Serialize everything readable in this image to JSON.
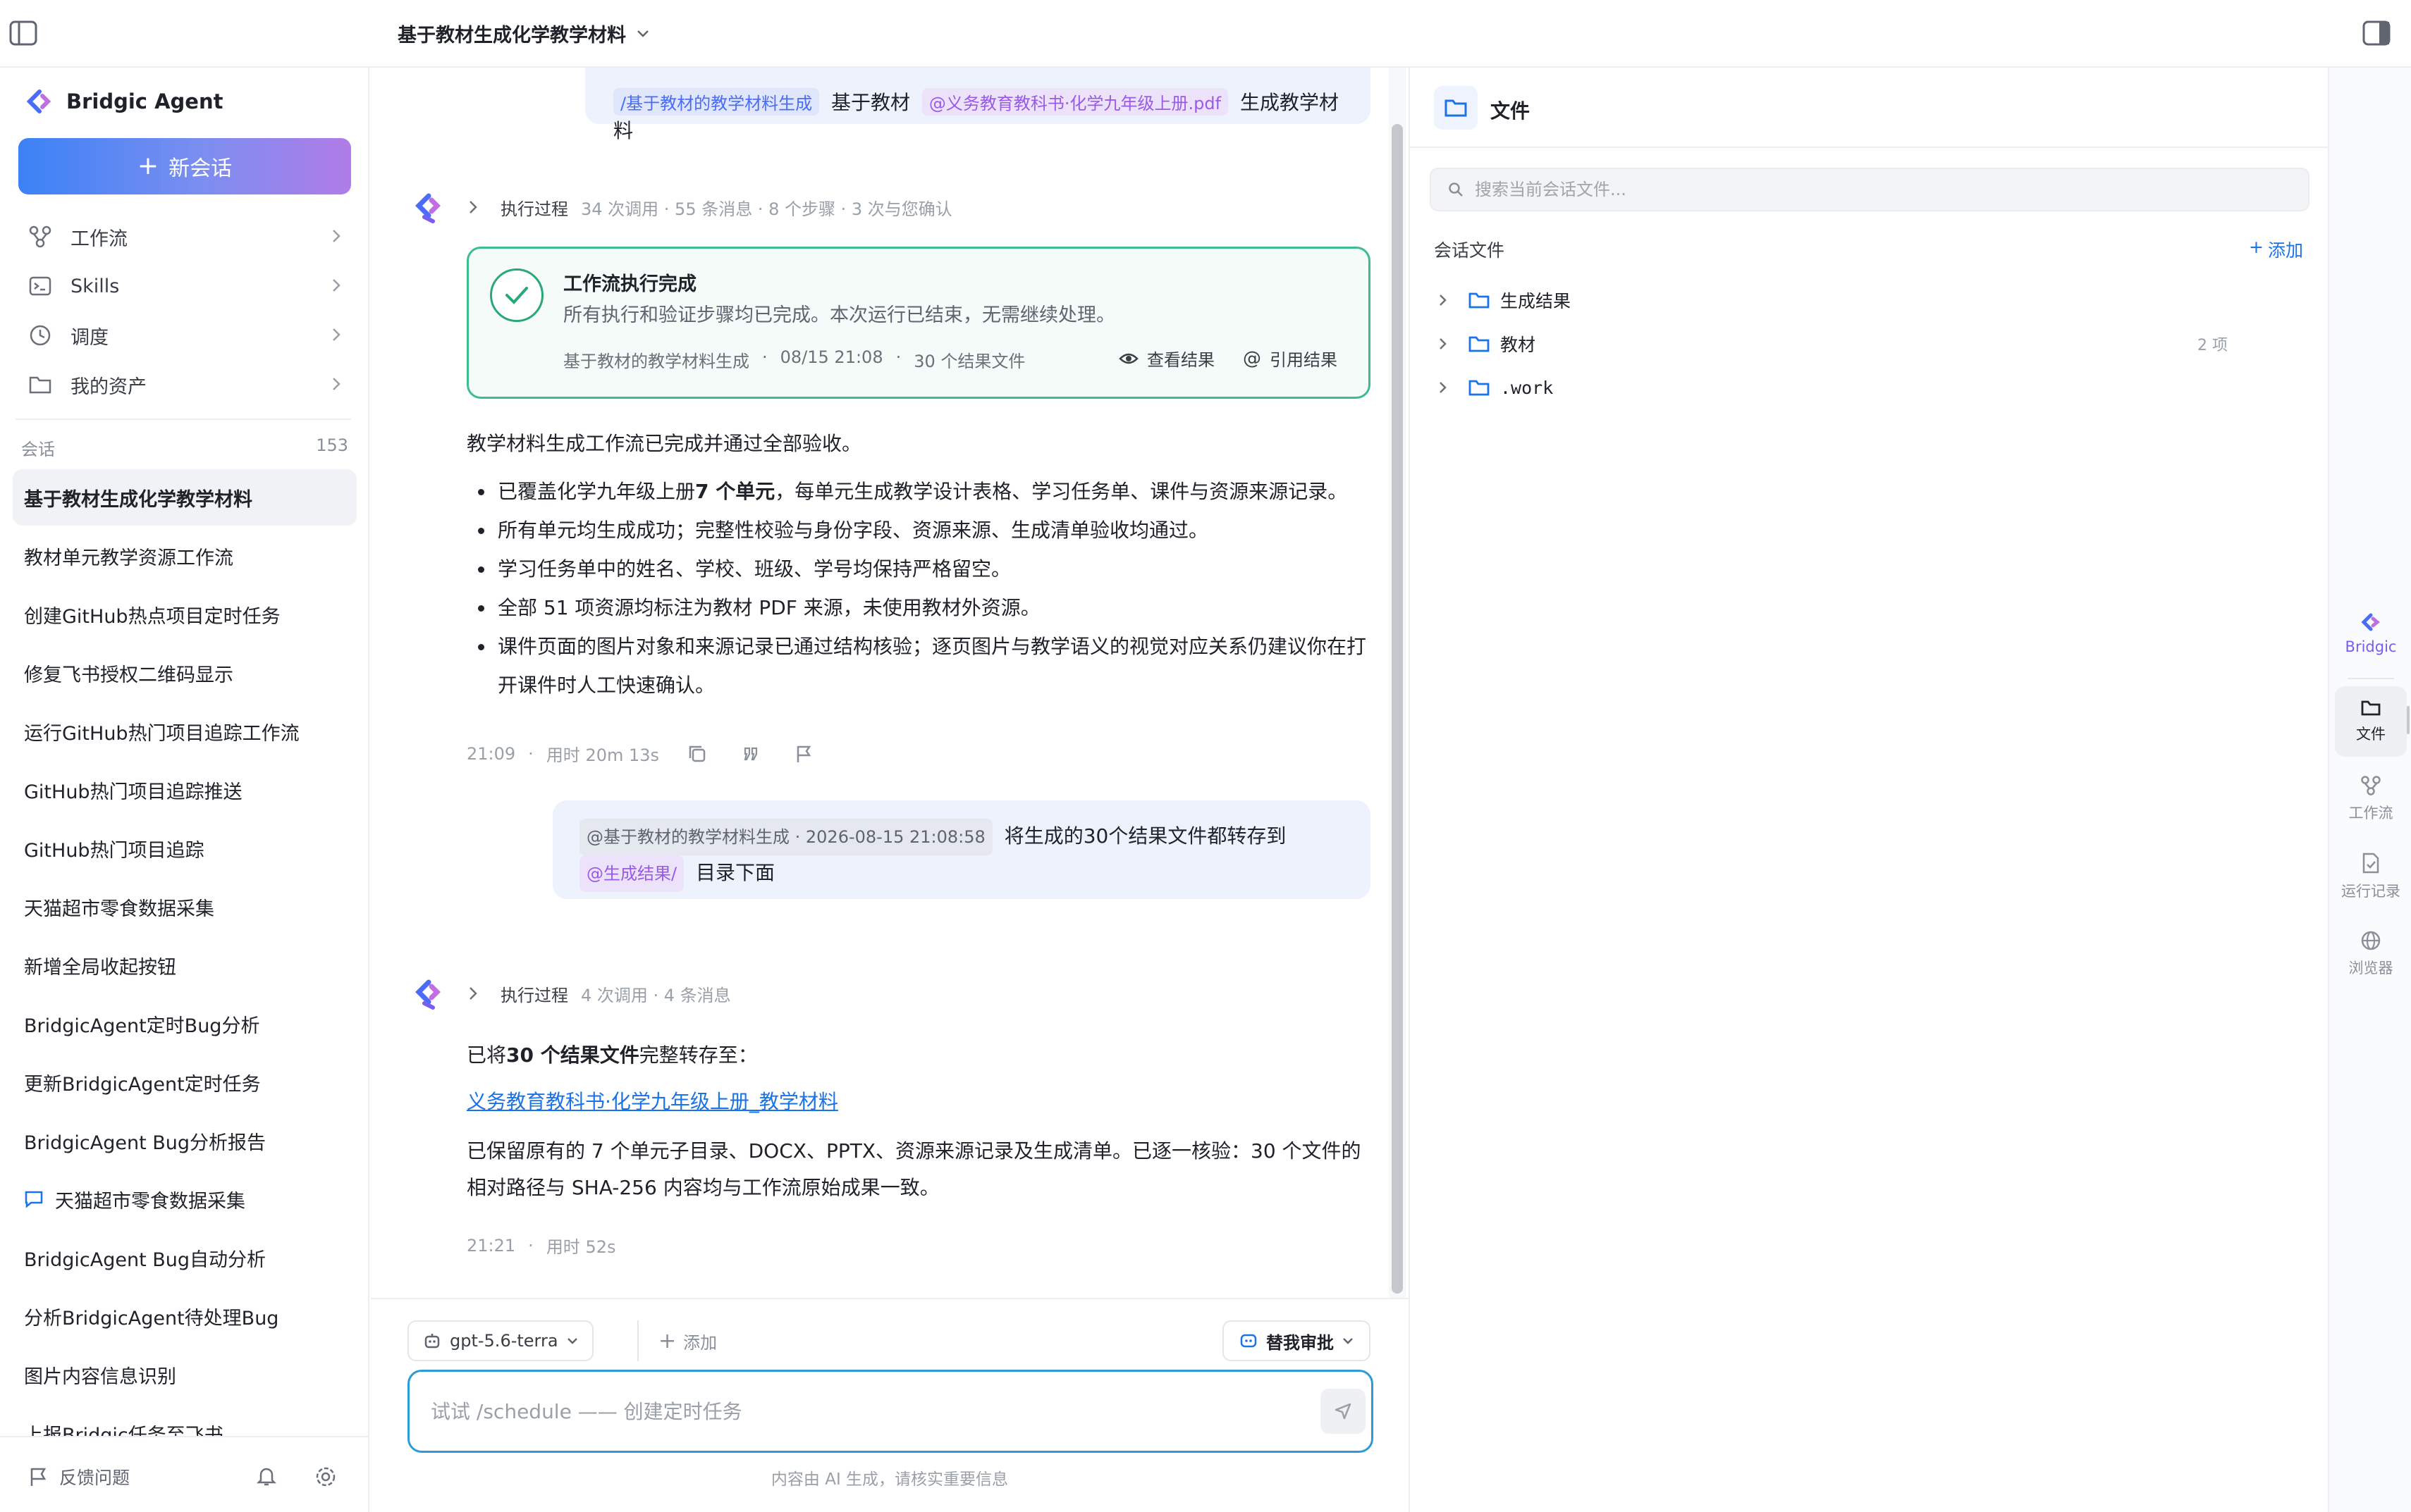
{
  "header": {
    "conversation_title": "基于教材生成化学教学材料"
  },
  "sidebar": {
    "brand": "Bridgic Agent",
    "new_chat_label": "新会话",
    "nav": [
      {
        "label": "工作流",
        "icon": "workflow-icon"
      },
      {
        "label": "Skills",
        "icon": "terminal-icon"
      },
      {
        "label": "调度",
        "icon": "clock-icon"
      },
      {
        "label": "我的资产",
        "icon": "folder-icon"
      }
    ],
    "sessions_label": "会话",
    "sessions_count": "153",
    "sessions": [
      {
        "title": "基于教材生成化学教学材料",
        "active": true
      },
      {
        "title": "教材单元教学资源工作流"
      },
      {
        "title": "创建GitHub热点项目定时任务"
      },
      {
        "title": "修复飞书授权二维码显示"
      },
      {
        "title": "运行GitHub热门项目追踪工作流"
      },
      {
        "title": "GitHub热门项目追踪推送"
      },
      {
        "title": "GitHub热门项目追踪"
      },
      {
        "title": "天猫超市零食数据采集"
      },
      {
        "title": "新增全局收起按钮"
      },
      {
        "title": "BridgicAgent定时Bug分析"
      },
      {
        "title": "更新BridgicAgent定时任务"
      },
      {
        "title": "BridgicAgent Bug分析报告"
      },
      {
        "title": "天猫超市零食数据采集",
        "icon": "chat-bubble-icon"
      },
      {
        "title": "BridgicAgent Bug自动分析"
      },
      {
        "title": "分析BridgicAgent待处理Bug"
      },
      {
        "title": "图片内容信息识别"
      },
      {
        "title": "上报Bridgic任务至飞书"
      }
    ],
    "footer": {
      "feedback_label": "反馈问题"
    }
  },
  "chat": {
    "msg1": {
      "tag_workflow": "/基于教材的教学材料生成",
      "text_a": "基于教材",
      "tag_file": "@义务教育教科书·化学九年级上册.pdf",
      "text_b": "生成教学材料"
    },
    "exec1": {
      "label": "执行过程",
      "stats": "34 次调用 · 55 条消息 · 8 个步骤 · 3 次与您确认"
    },
    "workflow_card": {
      "title": "工作流执行完成",
      "desc": "所有执行和验证步骤均已完成。本次运行已结束，无需继续处理。",
      "workflow_name": "基于教材的教学材料生成",
      "sep": "·",
      "time": "08/15 21:08",
      "files": "30 个结果文件",
      "view_label": "查看结果",
      "quote_label": "引用结果"
    },
    "reply1": {
      "intro": "教学材料生成工作流已完成并通过全部验收。",
      "b1_pre": "已覆盖化学九年级上册",
      "b1_bold": "7 个单元",
      "b1_post": "，每单元生成教学设计表格、学习任务单、课件与资源来源记录。",
      "b2": "所有单元均生成成功；完整性校验与身份字段、资源来源、生成清单验收均通过。",
      "b3": "学习任务单中的姓名、学校、班级、学号均保持严格留空。",
      "b4": "全部 51 项资源均标注为教材 PDF 来源，未使用教材外资源。",
      "b5": "课件页面的图片对象和来源记录已通过结构核验；逐页图片与教学语义的视觉对应关系仍建议你在打开课件时人工快速确认。",
      "time": "21:09",
      "duration": "用时 20m 13s"
    },
    "msg2": {
      "tag_ref": "@基于教材的教学材料生成 · 2026-08-15 21:08:58",
      "text_a": "将生成的30个结果文件都转存到",
      "tag_dir": "@生成结果/",
      "text_b": "目录下面"
    },
    "exec2": {
      "label": "执行过程",
      "stats": "4 次调用 · 4 条消息"
    },
    "reply2": {
      "p1_pre": "已将",
      "p1_bold": "30 个结果文件",
      "p1_post": "完整转存至：",
      "link": "义务教育教科书·化学九年级上册_教学材料",
      "p2": "已保留原有的 7 个单元子目录、DOCX、PPTX、资源来源记录及生成清单。已逐一核验：30 个文件的相对路径与 SHA-256 内容均与工作流原始成果一致。",
      "time": "21:21",
      "duration": "用时 52s"
    }
  },
  "composer": {
    "model": "gpt-5.6-terra",
    "add_label": "添加",
    "approval_label": "替我审批",
    "placeholder": "试试 /schedule —— 创建定时任务",
    "disclaimer": "内容由 AI 生成，请核实重要信息"
  },
  "file_panel": {
    "title": "文件",
    "search_placeholder": "搜索当前会话文件...",
    "section_label": "会话文件",
    "add_label": "添加",
    "tree": [
      {
        "name": "生成结果",
        "count": ""
      },
      {
        "name": "教材",
        "count": "2 项"
      },
      {
        "name": ".work",
        "count": ""
      }
    ]
  },
  "rail": {
    "items": [
      {
        "label": "Bridgic",
        "icon": "bridgic-logo-icon"
      },
      {
        "label": "文件",
        "icon": "folder-icon"
      },
      {
        "label": "工作流",
        "icon": "workflow-icon"
      },
      {
        "label": "运行记录",
        "icon": "file-check-icon"
      },
      {
        "label": "浏览器",
        "icon": "globe-icon"
      }
    ]
  },
  "colors": {
    "accent_blue": "#3b82f6",
    "accent_purple": "#b07ce8",
    "success_green": "#3ebd8c",
    "link_blue": "#1a73e8",
    "composer_border": "#2e9bd6"
  }
}
